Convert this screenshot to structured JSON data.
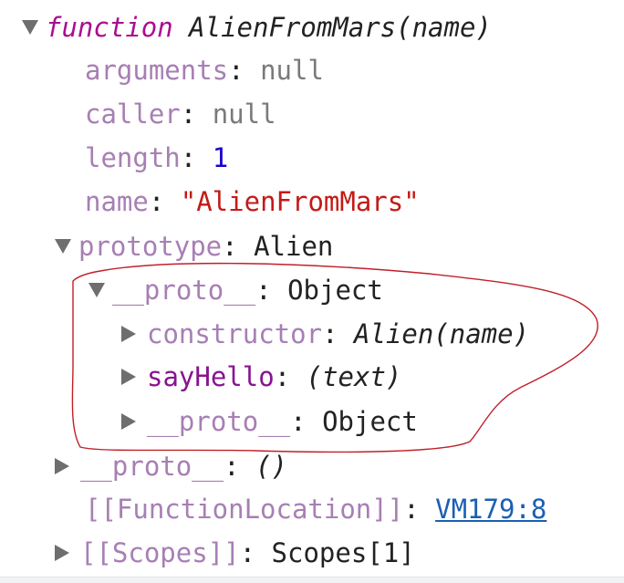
{
  "function_header": {
    "keyword": "function",
    "signature": "AlienFromMars(name)"
  },
  "properties": {
    "arguments": {
      "key": "arguments",
      "value": "null"
    },
    "caller": {
      "key": "caller",
      "value": "null"
    },
    "length": {
      "key": "length",
      "value": "1"
    },
    "name": {
      "key": "name",
      "value": "\"AlienFromMars\""
    }
  },
  "prototype": {
    "key": "prototype",
    "value": "Alien",
    "proto": {
      "key": "__proto__",
      "value": "Object",
      "constructor": {
        "key": "constructor",
        "value": "Alien(name)"
      },
      "sayHello": {
        "key": "sayHello",
        "value": "(text)"
      },
      "inner_proto": {
        "key": "__proto__",
        "value": "Object"
      }
    }
  },
  "outer_proto": {
    "key": "__proto__",
    "value": "()"
  },
  "function_location": {
    "key": "[[FunctionLocation]]",
    "value": "VM179:8"
  },
  "scopes": {
    "key": "[[Scopes]]",
    "value": "Scopes[1]"
  },
  "separator": ": ",
  "colors": {
    "property_key": "#9b4f96",
    "string_value": "#c41a16",
    "number_value": "#1c00cf",
    "annotation": "#c0202a",
    "link": "#1a5fb4"
  }
}
